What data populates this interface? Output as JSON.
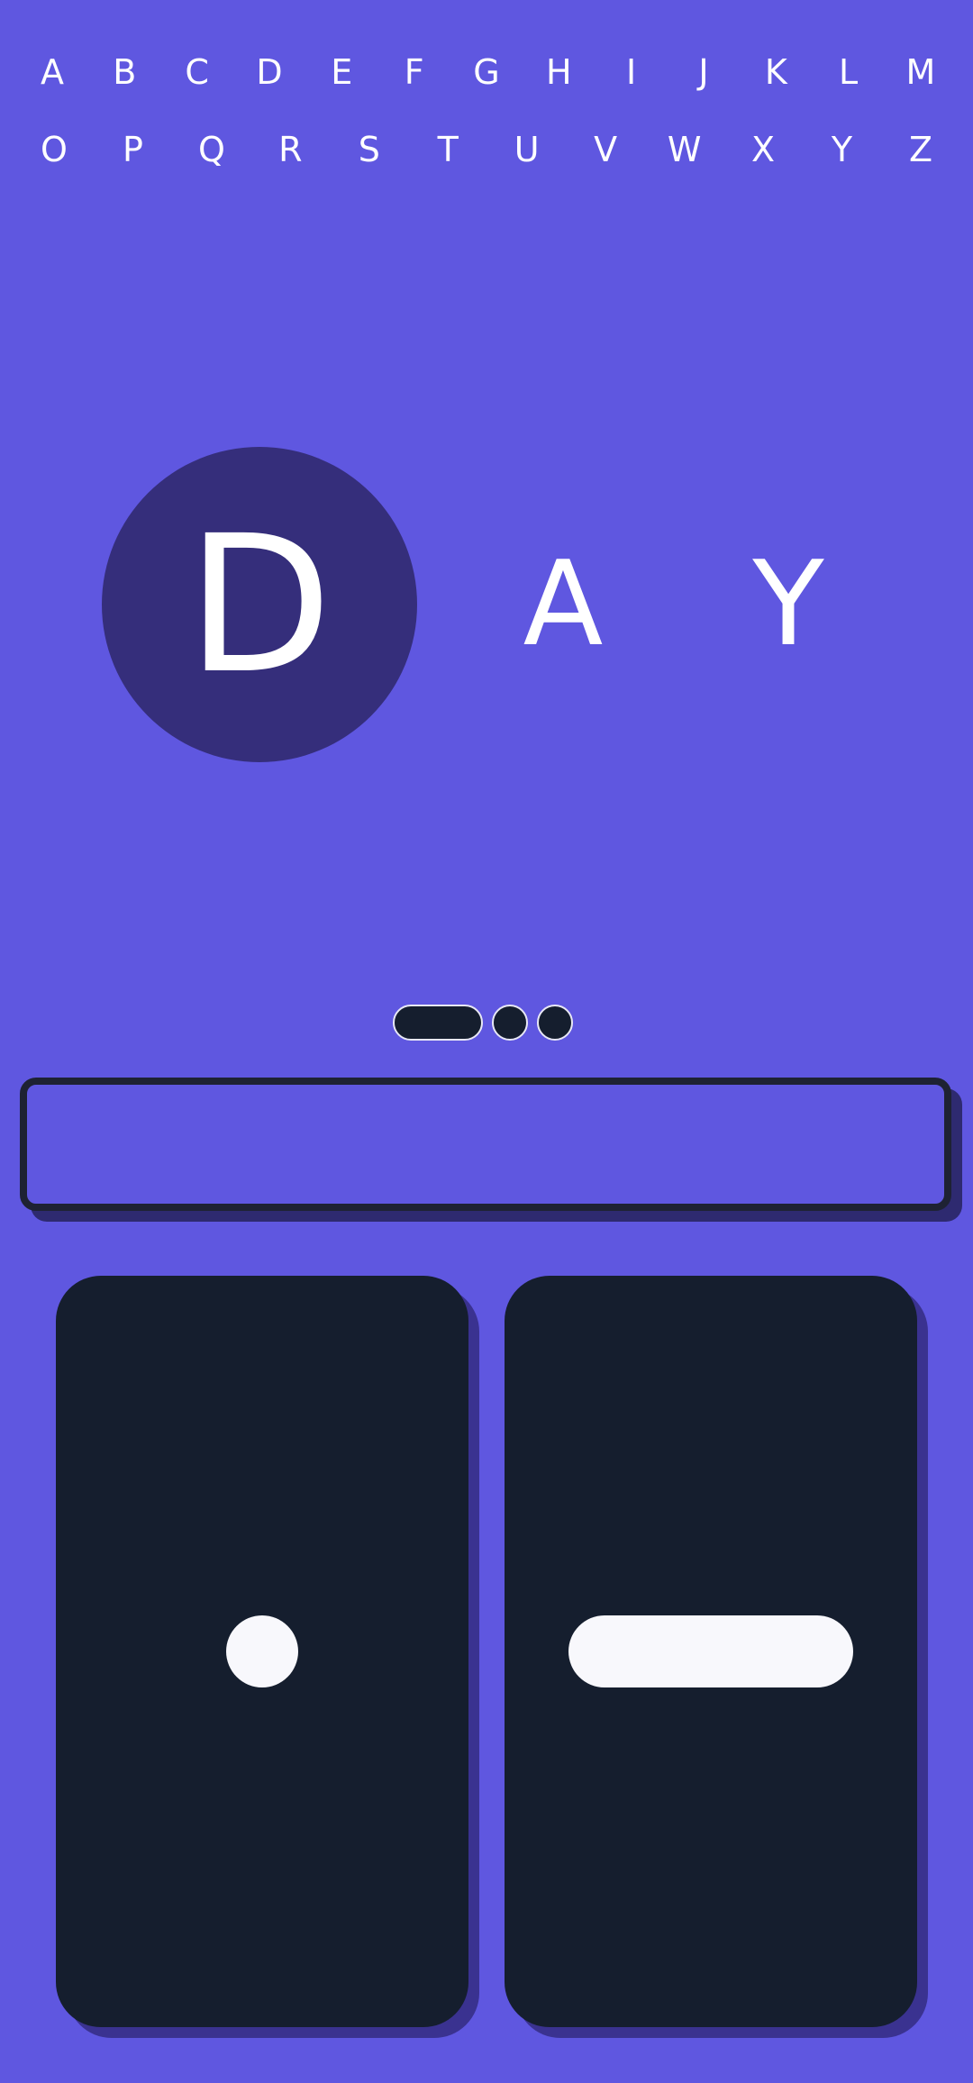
{
  "alphabet": {
    "row1": [
      "A",
      "B",
      "C",
      "D",
      "E",
      "F",
      "G",
      "H",
      "I",
      "J",
      "K",
      "L",
      "M"
    ],
    "row2": [
      "O",
      "P",
      "Q",
      "R",
      "S",
      "T",
      "U",
      "V",
      "W",
      "X",
      "Y",
      "Z"
    ]
  },
  "word": {
    "letters": [
      "D",
      "A",
      "Y"
    ],
    "active_index": 0
  },
  "pager": {
    "page_count": 3,
    "current_page": 1
  },
  "answer": {
    "value": ""
  },
  "controls": {
    "dot_icon": "dot-icon",
    "dash_icon": "dash-icon"
  },
  "colors": {
    "background": "#5F57E0",
    "active_circle": "#352E7B",
    "button": "#151E2E",
    "symbol": "#F8F8FC",
    "text": "#FFFFFF"
  }
}
